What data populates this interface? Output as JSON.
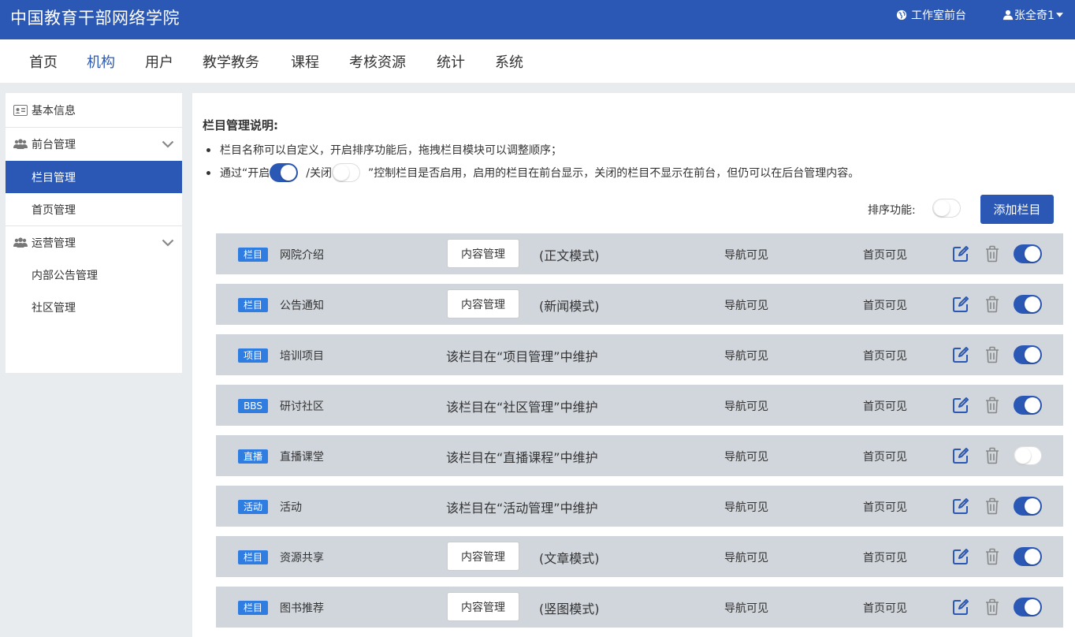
{
  "header": {
    "brand": "中国教育干部网络学院",
    "studio_link": "工作室前台",
    "user_name": "张全奇1"
  },
  "nav": {
    "items": [
      {
        "label": "首页",
        "active": false
      },
      {
        "label": "机构",
        "active": true
      },
      {
        "label": "用户",
        "active": false
      },
      {
        "label": "教学教务",
        "active": false
      },
      {
        "label": "课程",
        "active": false
      },
      {
        "label": "考核资源",
        "active": false
      },
      {
        "label": "统计",
        "active": false
      },
      {
        "label": "系统",
        "active": false
      }
    ]
  },
  "sidebar": {
    "basic_info": "基本信息",
    "front_mgmt": "前台管理",
    "column_mgmt": "栏目管理",
    "home_mgmt": "首页管理",
    "ops_mgmt": "运营管理",
    "notice_mgmt": "内部公告管理",
    "community_mgmt": "社区管理"
  },
  "intro": {
    "title": "栏目管理说明:",
    "line1": "栏目名称可以自定义，开启排序功能后，拖拽栏目模块可以调整顺序；",
    "line2_a": "通过“开启",
    "line2_b": "/关闭",
    "line2_c": "”控制栏目是否启用，启用的栏目在前台显示，关闭的栏目不显示在前台，但仍可以在后台管理内容。"
  },
  "toolbar": {
    "sort_label": "排序功能:",
    "add_button": "添加栏目"
  },
  "rows": [
    {
      "tag": "栏目",
      "name": "网院介绍",
      "button": "内容管理",
      "mode": "(正文模式)",
      "maint": "",
      "nav": "导航可见",
      "home": "首页可见",
      "enabled": true
    },
    {
      "tag": "栏目",
      "name": "公告通知",
      "button": "内容管理",
      "mode": "(新闻模式)",
      "maint": "",
      "nav": "导航可见",
      "home": "首页可见",
      "enabled": true
    },
    {
      "tag": "项目",
      "name": "培训项目",
      "button": "",
      "mode": "",
      "maint": "该栏目在“项目管理”中维护",
      "nav": "导航可见",
      "home": "首页可见",
      "enabled": true
    },
    {
      "tag": "BBS",
      "name": "研讨社区",
      "button": "",
      "mode": "",
      "maint": "该栏目在“社区管理”中维护",
      "nav": "导航可见",
      "home": "首页可见",
      "enabled": true
    },
    {
      "tag": "直播",
      "name": "直播课堂",
      "button": "",
      "mode": "",
      "maint": "该栏目在“直播课程”中维护",
      "nav": "导航可见",
      "home": "首页可见",
      "enabled": false
    },
    {
      "tag": "活动",
      "name": "活动",
      "button": "",
      "mode": "",
      "maint": "该栏目在“活动管理”中维护",
      "nav": "导航可见",
      "home": "首页可见",
      "enabled": true
    },
    {
      "tag": "栏目",
      "name": "资源共享",
      "button": "内容管理",
      "mode": "(文章模式)",
      "maint": "",
      "nav": "导航可见",
      "home": "首页可见",
      "enabled": true
    },
    {
      "tag": "栏目",
      "name": "图书推荐",
      "button": "内容管理",
      "mode": "(竖图模式)",
      "maint": "",
      "nav": "导航可见",
      "home": "首页可见",
      "enabled": true
    }
  ],
  "colors": {
    "primary": "#2b58b5",
    "tag": "#2f7de1",
    "row_bg": "#d0d6dc"
  }
}
